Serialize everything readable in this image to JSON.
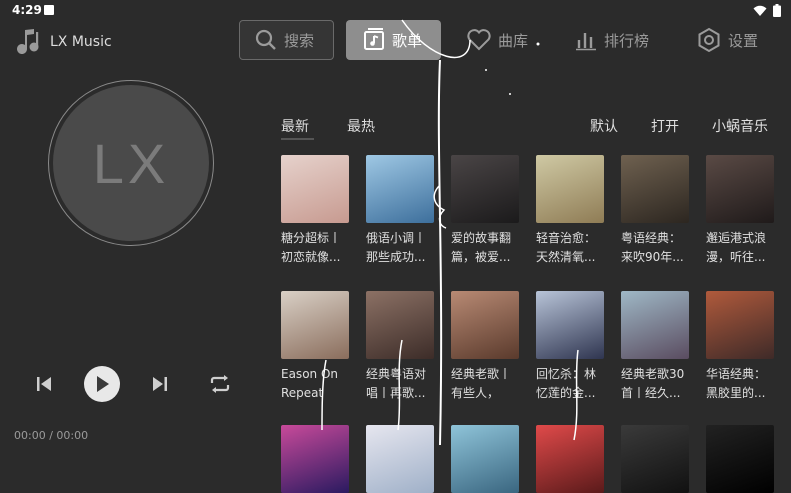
{
  "status_bar": {
    "time": "4:29"
  },
  "app": {
    "title": "LX Music"
  },
  "nav": {
    "search_label": "搜索",
    "songlist_label": "歌单",
    "library_label": "曲库",
    "ranking_label": "排行榜",
    "settings_label": "设置"
  },
  "player": {
    "avatar_text": "LX",
    "time": "00:00 / 00:00"
  },
  "tabs": {
    "latest": "最新",
    "hottest": "最热"
  },
  "sort": {
    "default": "默认",
    "open": "打开",
    "source": "小蜗音乐"
  },
  "playlists": [
    {
      "line1": "糖分超标丨",
      "line2": "初恋就像...",
      "color1": "#e6d2cc",
      "color2": "#c79a90"
    },
    {
      "line1": "俄语小调丨",
      "line2": "那些成功...",
      "color1": "#9fc8e4",
      "color2": "#3d6f9c"
    },
    {
      "line1": "爱的故事翻",
      "line2": "篇，被爱...",
      "color1": "#4a4546",
      "color2": "#1b1a1b"
    },
    {
      "line1": "轻音治愈：",
      "line2": "天然清氧...",
      "color1": "#cfc9a4",
      "color2": "#8f7c55"
    },
    {
      "line1": "粤语经典：",
      "line2": "来吹90年...",
      "color1": "#6f6150",
      "color2": "#2c2620"
    },
    {
      "line1": "邂逅港式浪",
      "line2": "漫，听往...",
      "color1": "#5a4a45",
      "color2": "#1f1a1a"
    },
    {
      "line1": "Eason On",
      "line2": "Repeat",
      "color1": "#d9d0c6",
      "color2": "#8a6d5c"
    },
    {
      "line1": "经典粤语对",
      "line2": "唱丨再歌...",
      "color1": "#8c7165",
      "color2": "#3c2c28"
    },
    {
      "line1": "经典老歌丨",
      "line2": "有些人，",
      "color1": "#b88a74",
      "color2": "#5a3a2c"
    },
    {
      "line1": "回忆杀：林",
      "line2": "忆莲的金...",
      "color1": "#b8c4d8",
      "color2": "#2f3550"
    },
    {
      "line1": "经典老歌30",
      "line2": "首丨经久...",
      "color1": "#9fb8c6",
      "color2": "#5a4c60"
    },
    {
      "line1": "华语经典：",
      "line2": "黑胶里的...",
      "color1": "#b05a3c",
      "color2": "#3e2a28"
    },
    {
      "line1": "",
      "line2": "",
      "color1": "#c84a9a",
      "color2": "#2a1a60"
    },
    {
      "line1": "",
      "line2": "",
      "color1": "#e6e6ef",
      "color2": "#9fb0c8"
    },
    {
      "line1": "",
      "line2": "",
      "color1": "#8fc4d9",
      "color2": "#3a6680"
    },
    {
      "line1": "",
      "line2": "",
      "color1": "#e04a4a",
      "color2": "#5a1a1a"
    },
    {
      "line1": "",
      "line2": "",
      "color1": "#3a3a3a",
      "color2": "#111111"
    },
    {
      "line1": "",
      "line2": "",
      "color1": "#222222",
      "color2": "#000000"
    }
  ],
  "colors": {
    "background": "#2b2b2b",
    "active_nav": "#8e8e8e",
    "text": "#e6e6e6"
  }
}
